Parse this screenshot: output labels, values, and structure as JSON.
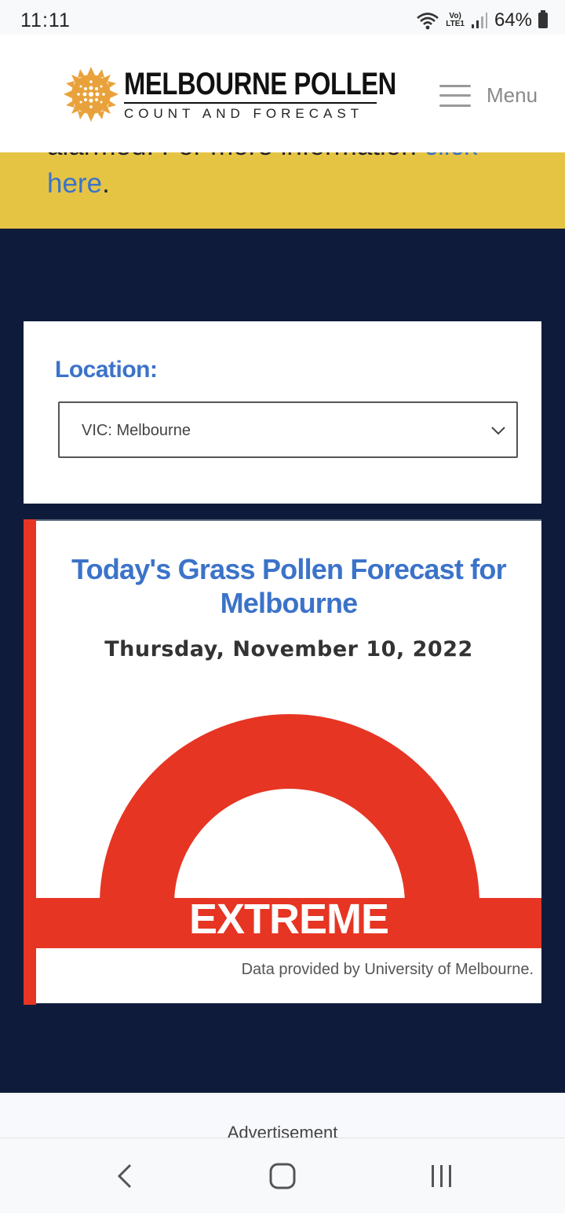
{
  "status_bar": {
    "time": "11:11",
    "network_top": "Vo)",
    "network_bottom": "LTE1",
    "battery": "64%"
  },
  "header": {
    "logo_title": "MELBOURNE POLLEN",
    "logo_subtitle": "COUNT AND FORECAST",
    "menu_label": "Menu"
  },
  "alert": {
    "cut_text": "alarmed. For more information ",
    "cut_link": "click",
    "link_text": "here",
    "after_link": "."
  },
  "location": {
    "label": "Location:",
    "selected": "VIC: Melbourne"
  },
  "forecast": {
    "title": "Today's Grass Pollen Forecast for Melbourne",
    "date": "Thursday, November 10, 2022",
    "level": "EXTREME",
    "credit": "Data provided by University of Melbourne.",
    "level_color": "#e63523"
  },
  "ad": {
    "label": "Advertisement"
  },
  "colors": {
    "brand_blue": "#3b73c9",
    "page_navy": "#0e1b3a",
    "alert_yellow": "#e5c444",
    "logo_orange": "#e9a23b"
  },
  "icons": [
    "wifi-icon",
    "signal-icon",
    "battery-icon",
    "pollen-sun-logo-icon",
    "hamburger-icon",
    "chevron-down-icon",
    "back-icon",
    "home-icon",
    "recents-icon"
  ]
}
